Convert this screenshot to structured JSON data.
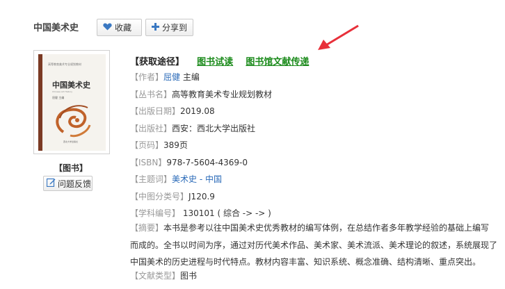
{
  "header": {
    "title": "中国美术史",
    "favorite_label": "收藏",
    "share_label": "分享到"
  },
  "cover": {
    "small_text": "高等教育美术专业规划教材",
    "title": "中国美术史",
    "subtitle": "Chinese Art History",
    "author": "屈健 主编",
    "publisher": "西北大学出版社"
  },
  "sidebar": {
    "type_label": "【图书】",
    "feedback_label": "问题反馈"
  },
  "access": {
    "label": "【获取途径】",
    "link_trial": "图书试读",
    "link_library": "图书馆文献传递"
  },
  "details": {
    "author_key": "【作者】",
    "author_name": "屈健",
    "author_role": " 主编",
    "series_key": "【丛书名】",
    "series_val": "高等教育美术专业规划教材",
    "date_key": "【出版日期】",
    "date_val": "2019.08",
    "publisher_key": "【出版社】",
    "publisher_val": "西安：西北大学出版社",
    "pages_key": "【页码】",
    "pages_val": "389页",
    "isbn_key": "【ISBN】",
    "isbn_val": "978-7-5604-4369-0",
    "subject_key": "【主题词】",
    "subject_val": "美术史 - 中国",
    "clc_key": "【中图分类号】",
    "clc_val": "J120.9",
    "discipline_key": "【学科编号】",
    "discipline_val": " 130101 ( 综合 -> -> )",
    "abstract_key": "【摘要】",
    "abstract_val": "本书是参考以往中国美术史优秀教材的编写体例，在总结作者多年教学经验的基础上编写而成的。全书以时间为序，通过对历代美术作品、美术家、美术流派、美术理论的叙述，系统展现了中国美术的历史进程与时代特点。教材内容丰富、知识系统、概念准确、结构清晰、重点突出。",
    "doctype_key": "【文献类型】",
    "doctype_val": "图书"
  },
  "colors": {
    "link_green": "#1a8a1a",
    "link_blue": "#2a6ab8",
    "arrow_red": "#e8303a",
    "key_gray": "#999999"
  }
}
